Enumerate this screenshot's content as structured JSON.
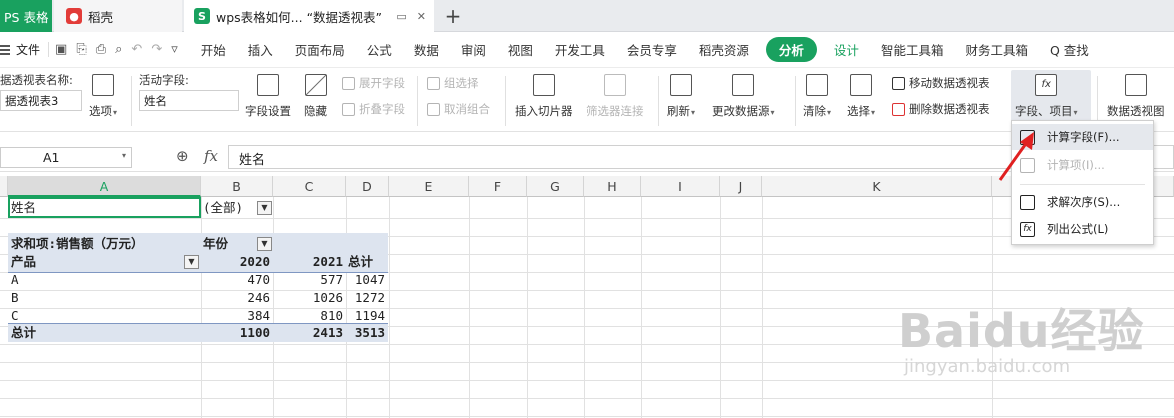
{
  "tabs": {
    "wps_label": "PS 表格",
    "docer_label": "稻壳",
    "doc_label": "wps表格如何... “数据透视表”"
  },
  "menubar": {
    "file": "文件",
    "items": [
      "开始",
      "插入",
      "页面布局",
      "公式",
      "数据",
      "审阅",
      "视图",
      "开发工具",
      "会员专享",
      "稻壳资源"
    ],
    "analyze": "分析",
    "design": "设计",
    "smart_toolbox": "智能工具箱",
    "finance_toolbox": "财务工具箱",
    "search": "Q 查找"
  },
  "ribbon": {
    "pivot_name_label": "据透视表名称:",
    "pivot_name_value": "据透视表3",
    "options": "选项",
    "active_field_label": "活动字段:",
    "active_field_value": "姓名",
    "field_settings": "字段设置",
    "hide": "隐藏",
    "expand_field": "展开字段",
    "collapse_field": "折叠字段",
    "group_selection": "组选择",
    "ungroup": "取消组合",
    "insert_slicer": "插入切片器",
    "filter_connections": "筛选器连接",
    "refresh": "刷新",
    "change_source": "更改数据源",
    "clear": "清除",
    "select": "选择",
    "move_pivot": "移动数据透视表",
    "delete_pivot": "删除数据透视表",
    "fields_items": "字段、项目",
    "pivot_chart": "数据透视图"
  },
  "formula_bar": {
    "name_box": "A1",
    "fx": "fx",
    "content": "姓名"
  },
  "columns": [
    "A",
    "B",
    "C",
    "D",
    "E",
    "F",
    "G",
    "H",
    "I",
    "J",
    "K"
  ],
  "grid": {
    "filter_label": "姓名",
    "filter_value": "(全部)",
    "value_field": "求和项:销售额（万元）",
    "col_field": "年份",
    "row_field": "产品",
    "year1": "2020",
    "year2": "2021",
    "total_label": "总计",
    "rows": [
      {
        "product": "A",
        "y2020": "470",
        "y2021": "577",
        "total": "1047"
      },
      {
        "product": "B",
        "y2020": "246",
        "y2021": "1026",
        "total": "1272"
      },
      {
        "product": "C",
        "y2020": "384",
        "y2021": "810",
        "total": "1194"
      }
    ],
    "grand_total_label": "总计",
    "grand_2020": "1100",
    "grand_2021": "2413",
    "grand_total": "3513"
  },
  "context_menu": {
    "calc_field": "计算字段(F)...",
    "calc_item": "计算项(I)...",
    "solve_order": "求解次序(S)...",
    "list_formulas": "列出公式(L)"
  },
  "watermark": {
    "brand": "Baidu经验",
    "url": "jingyan.baidu.com"
  },
  "colors": {
    "wps_green": "#19a15f",
    "docer_red": "#e23c39",
    "arrow_red": "#e02020",
    "pivot_band": "#dde4ef"
  }
}
